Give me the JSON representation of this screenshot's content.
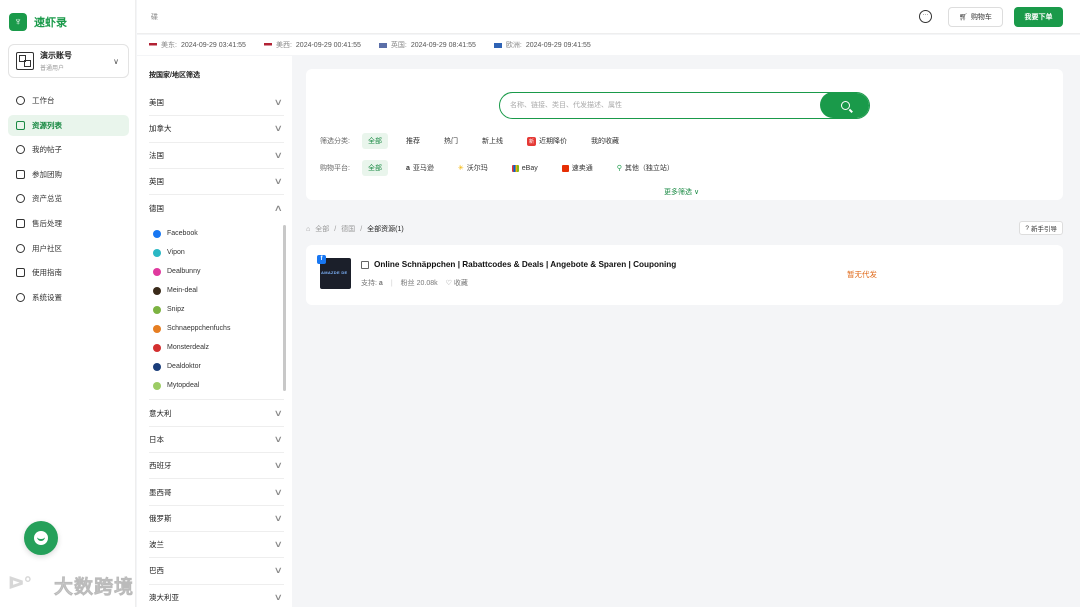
{
  "app": {
    "name": "速虾录"
  },
  "account": {
    "name": "演示账号",
    "role": "普通用户"
  },
  "nav": [
    {
      "label": "工作台",
      "icon": "dashboard-icon",
      "active": false
    },
    {
      "label": "资源列表",
      "icon": "list-icon",
      "active": true
    },
    {
      "label": "我的帖子",
      "icon": "post-icon",
      "active": false
    },
    {
      "label": "参加团购",
      "icon": "group-buy-icon",
      "active": false
    },
    {
      "label": "资产总览",
      "icon": "assets-icon",
      "active": false
    },
    {
      "label": "售后处理",
      "icon": "after-sales-icon",
      "active": false
    },
    {
      "label": "用户社区",
      "icon": "community-icon",
      "active": false
    },
    {
      "label": "使用指南",
      "icon": "guide-icon",
      "active": false
    },
    {
      "label": "系统设置",
      "icon": "settings-icon",
      "active": false
    }
  ],
  "topbar": {
    "placeholder": "碟",
    "cart_label": "购物车",
    "order_label": "我要下单"
  },
  "timezones": [
    {
      "label": "美东:",
      "time": "2024-09-29 03:41:55"
    },
    {
      "label": "美西:",
      "time": "2024-09-29 00:41:55"
    },
    {
      "label": "英国:",
      "time": "2024-09-29 08:41:55"
    },
    {
      "label": "欧洲:",
      "time": "2024-09-29 09:41:55"
    }
  ],
  "country_filter": {
    "title": "按国家/地区筛选",
    "before": [
      "美国",
      "加拿大",
      "法国",
      "英国"
    ],
    "expanded": {
      "label": "德国",
      "items": [
        "Facebook",
        "Vipon",
        "Dealbunny",
        "Mein-deal",
        "Snipz",
        "Schnaeppchenfuchs",
        "Monsterdealz",
        "Dealdoktor",
        "Mytopdeal"
      ]
    },
    "after": [
      "意大利",
      "日本",
      "西班牙",
      "墨西哥",
      "俄罗斯",
      "波兰",
      "巴西",
      "澳大利亚"
    ]
  },
  "search": {
    "placeholder": "名称、链接、类目、代发描述、属性"
  },
  "filters": {
    "category_label": "筛选分类:",
    "categories": [
      "全部",
      "推荐",
      "热门",
      "新上线",
      "近期降价",
      "我的收藏"
    ],
    "new_badge": "新",
    "platform_label": "购物平台:",
    "platforms": [
      "全部",
      "亚马逊",
      "沃尔玛",
      "eBay",
      "速卖通",
      "其他（独立站）"
    ],
    "more": "更多筛选 ∨"
  },
  "breadcrumb": {
    "root": "全部",
    "country": "德国",
    "current": "全部资源(1)",
    "guide": "新手引导"
  },
  "result": {
    "title": "Online Schnäppchen | Rabattcodes & Deals | Angebote & Sparen | Couponing",
    "support_label": "支持:",
    "fans": "粉丝 20.08k",
    "favorite": "收藏",
    "status": "暂无代发",
    "thumb_text": "AMAZDE DE"
  },
  "colors": {
    "brand": "#1a9a4a",
    "status": "#e06a1a"
  }
}
